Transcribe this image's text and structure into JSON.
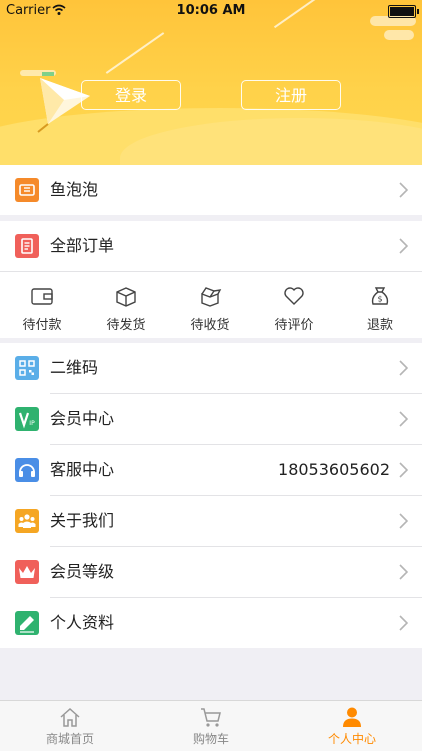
{
  "status_bar": {
    "carrier": "Carrier",
    "time": "10:06 AM"
  },
  "header": {
    "login_label": "登录",
    "register_label": "注册"
  },
  "bubble": {
    "label": "鱼泡泡"
  },
  "orders": {
    "all_label": "全部订单",
    "states": [
      {
        "label": "待付款",
        "icon": "wallet-icon"
      },
      {
        "label": "待发货",
        "icon": "box-icon"
      },
      {
        "label": "待收货",
        "icon": "open-box-icon"
      },
      {
        "label": "待评价",
        "icon": "heart-icon"
      },
      {
        "label": "退款",
        "icon": "money-bag-icon"
      }
    ]
  },
  "menu": [
    {
      "label": "二维码",
      "icon": "qr-code-icon",
      "color": "#5aaee8"
    },
    {
      "label": "会员中心",
      "icon": "vip-icon",
      "color": "#2fb26f"
    },
    {
      "label": "客服中心",
      "icon": "headset-icon",
      "color": "#4a8ee6",
      "value": "18053605602"
    },
    {
      "label": "关于我们",
      "icon": "people-icon",
      "color": "#f5a623"
    },
    {
      "label": "会员等级",
      "icon": "crown-icon",
      "color": "#f0605a"
    },
    {
      "label": "个人资料",
      "icon": "pencil-icon",
      "color": "#2fb26f"
    }
  ],
  "tabbar": {
    "tabs": [
      {
        "label": "商城首页",
        "icon": "home-icon"
      },
      {
        "label": "购物车",
        "icon": "cart-icon"
      },
      {
        "label": "个人中心",
        "icon": "person-icon",
        "active": true
      }
    ]
  },
  "colors": {
    "accent": "#ff8a00",
    "header": "#ffc43a",
    "bubble_icon": "#f58a2a",
    "order_icon": "#f0605a"
  }
}
